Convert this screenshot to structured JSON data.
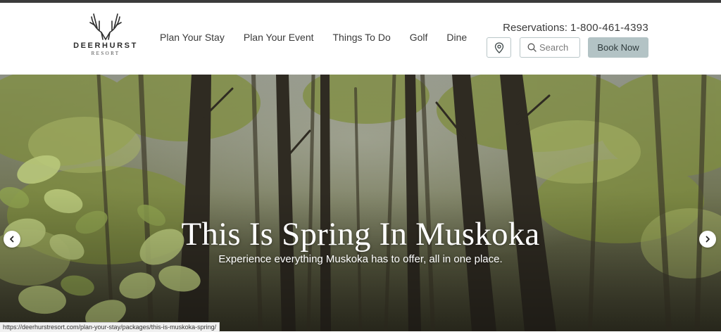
{
  "brand": {
    "name": "DEERHURST",
    "subtitle": "RESORT"
  },
  "nav": {
    "items": [
      {
        "label": "Plan Your Stay"
      },
      {
        "label": "Plan Your Event"
      },
      {
        "label": "Things To Do"
      },
      {
        "label": "Golf"
      },
      {
        "label": "Dine"
      }
    ]
  },
  "header": {
    "reservations_label": "Reservations:",
    "phone": "1-800-461-4393",
    "location_icon": "map-pin-icon",
    "search": {
      "placeholder": "Search",
      "icon": "search-icon"
    },
    "book_label": "Book Now"
  },
  "hero": {
    "title": "This Is Spring In Muskoka",
    "subtitle": "Experience everything Muskoka has to offer, all in one place.",
    "prev_icon": "chevron-left-icon",
    "next_icon": "chevron-right-icon"
  },
  "status_bar": {
    "url": "https://deerhurstresort.com/plan-your-stay/packages/this-is-muskoka-spring/"
  },
  "colors": {
    "accent": "#b3c3c5",
    "border": "#b9c6c8",
    "text": "#3a3a3a",
    "forest_light": "#a5b466",
    "forest_dark": "#3d3a2a"
  }
}
